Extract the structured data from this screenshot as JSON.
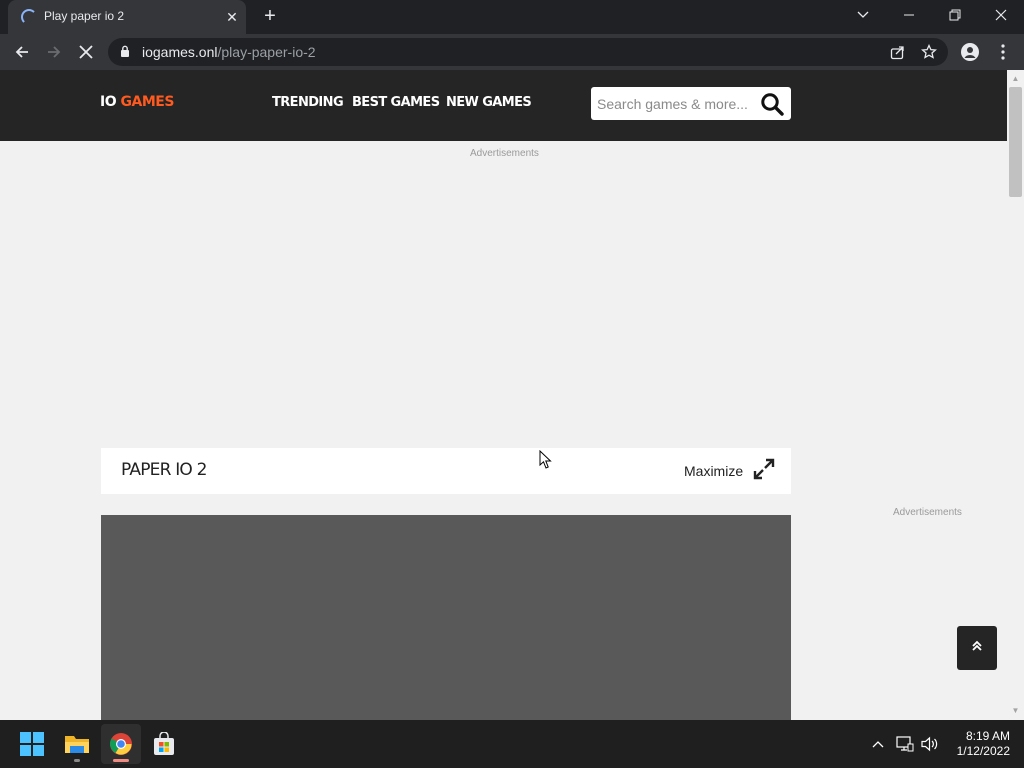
{
  "browser": {
    "tab_title": "Play paper io 2",
    "tab_close_icon": "close-icon",
    "new_tab_icon": "plus-icon",
    "url_host": "iogames.onl",
    "url_path": "/play-paper-io-2"
  },
  "site": {
    "logo_io": "IO",
    "logo_games": "GAMES",
    "nav": [
      "TRENDING",
      "BEST GAMES",
      "NEW GAMES"
    ],
    "search_placeholder": "Search games & more...",
    "accent_color": "#ff5a1f",
    "header_color": "#252525"
  },
  "ads": {
    "top_label": "Advertisements",
    "side_label": "Advertisements"
  },
  "game": {
    "title": "PAPER IO 2",
    "maximize_label": "Maximize"
  },
  "taskbar": {
    "time": "8:19 AM",
    "date": "1/12/2022"
  }
}
